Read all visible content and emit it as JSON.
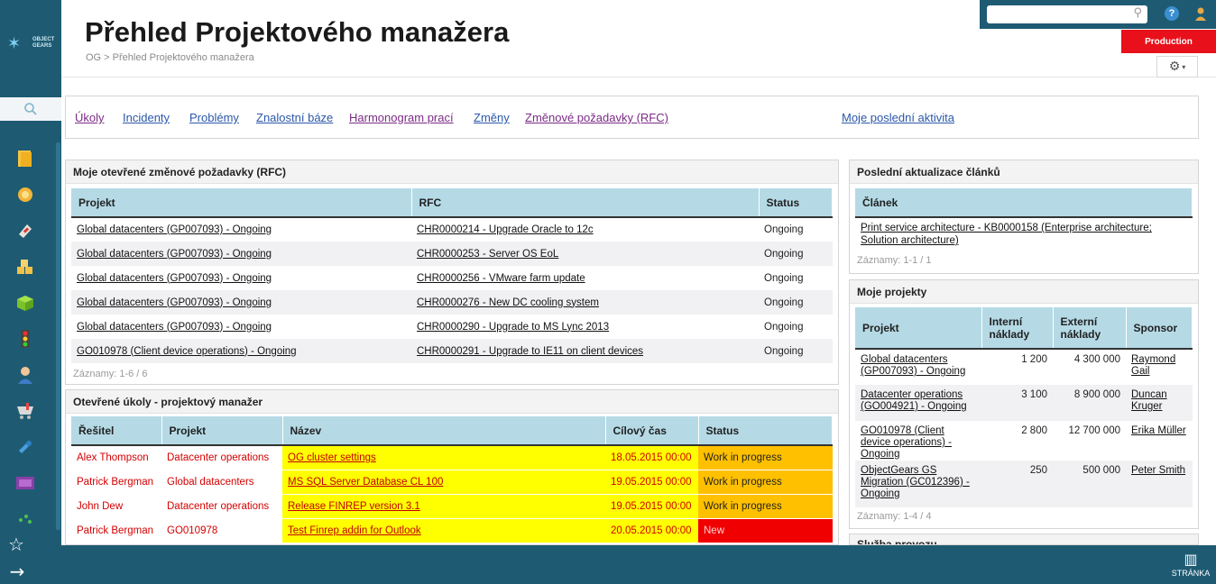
{
  "app": {
    "logo_text_line1": "OBJECT",
    "logo_text_line2": "GEARS",
    "title": "Přehled Projektového manažera",
    "breadcrumb": "OG > Přehled Projektového manažera",
    "environment": "Production",
    "page_button_label": "STRÁNKA"
  },
  "colors": {
    "sidebar": "#1e5b73",
    "production_badge": "#e8101a",
    "table_header": "#b5dae6",
    "task_yellow": "#ffff00",
    "task_orange": "#ffc000",
    "task_red": "#f00000"
  },
  "sidebar": {
    "icons": [
      "folder-icon",
      "badge-icon",
      "tag-icon",
      "coins-icon",
      "cube-icon",
      "traffic-light-icon",
      "person-icon",
      "cart-icon",
      "wrench-icon",
      "screen-icon",
      "sparkle-icon"
    ]
  },
  "quicklinks": [
    {
      "label": "Úkoly",
      "visited": true
    },
    {
      "label": "Incidenty",
      "visited": false
    },
    {
      "label": "Problémy",
      "visited": false
    },
    {
      "label": "Znalostní báze",
      "visited": false
    },
    {
      "label": "Harmonogram prací",
      "visited": true
    },
    {
      "label": "Změny",
      "visited": false
    },
    {
      "label": "Změnové požadavky (RFC)",
      "visited": true
    },
    {
      "label": "Moje poslední aktivita",
      "visited": false
    }
  ],
  "rfc_panel": {
    "title": "Moje otevřené změnové požadavky (RFC)",
    "columns": [
      "Projekt",
      "RFC",
      "Status"
    ],
    "rows": [
      [
        "Global datacenters (GP007093) - Ongoing",
        "CHR0000214 - Upgrade Oracle to 12c",
        "Ongoing"
      ],
      [
        "Global datacenters (GP007093) - Ongoing",
        "CHR0000253 - Server OS EoL",
        "Ongoing"
      ],
      [
        "Global datacenters (GP007093) - Ongoing",
        "CHR0000256 - VMware farm update",
        "Ongoing"
      ],
      [
        "Global datacenters (GP007093) - Ongoing",
        "CHR0000276 - New DC cooling system",
        "Ongoing"
      ],
      [
        "Global datacenters (GP007093) - Ongoing",
        "CHR0000290 - Upgrade to MS Lync 2013",
        "Ongoing"
      ],
      [
        "GO010978 (Client device operations) - Ongoing",
        "CHR0000291 - Upgrade to IE11 on client devices",
        "Ongoing"
      ]
    ],
    "records": "Záznamy: 1-6 / 6"
  },
  "tasks_panel": {
    "title": "Otevřené úkoly - projektový manažer",
    "columns": [
      "Řešitel",
      "Projekt",
      "Název",
      "Cílový čas",
      "Status"
    ],
    "rows": [
      [
        "Alex Thompson",
        "Datacenter operations",
        "OG cluster settings",
        "18.05.2015 00:00",
        "Work in progress"
      ],
      [
        "Patrick Bergman",
        "Global datacenters",
        "MS SQL Server Database CL 100",
        "19.05.2015 00:00",
        "Work in progress"
      ],
      [
        "John Dew",
        "Datacenter operations",
        "Release FINREP version 3.1",
        "19.05.2015 00:00",
        "Work in progress"
      ],
      [
        "Patrick Bergman",
        "GO010978",
        "Test Finrep addin for Outlook",
        "20.05.2015 00:00",
        "New"
      ]
    ]
  },
  "articles_panel": {
    "title": "Poslední aktualizace článků",
    "column": "Článek",
    "rows": [
      "Print service architecture - KB0000158 (Enterprise architecture; Solution architecture)"
    ],
    "records": "Záznamy: 1-1 / 1"
  },
  "projects_panel": {
    "title": "Moje projekty",
    "columns": [
      "Projekt",
      "Interní náklady",
      "Externí náklady",
      "Sponsor"
    ],
    "rows": [
      [
        "Global datacenters (GP007093) - Ongoing",
        "1 200",
        "4 300 000",
        "Raymond Gail"
      ],
      [
        "Datacenter operations (GO004921) - Ongoing",
        "3 100",
        "8 900 000",
        "Duncan Kruger"
      ],
      [
        "GO010978 (Client device operations) - Ongoing",
        "2 800",
        "12 700 000",
        "Erika Müller"
      ],
      [
        "ObjectGears GS Migration (GC012396) - Ongoing",
        "250",
        "500 000",
        "Peter Smith"
      ]
    ],
    "records": "Záznamy: 1-4 / 4"
  },
  "service_panel": {
    "title": "Služba provozu"
  }
}
